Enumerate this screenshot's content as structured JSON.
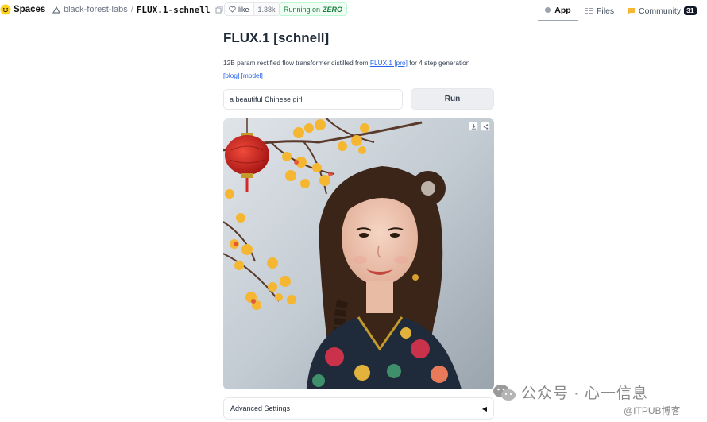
{
  "header": {
    "brand": "Spaces",
    "org": "black-forest-labs",
    "separator": "/",
    "repo": "FLUX.1-schnell",
    "like_label": "like",
    "like_count": "1.38k",
    "status_prefix": "Running on",
    "status_hw": "ZERO",
    "nav": {
      "app": "App",
      "files": "Files",
      "community": "Community",
      "community_count": "31"
    }
  },
  "main": {
    "title": "FLUX.1 [schnell]",
    "desc_before": "12B param rectified flow transformer distilled from ",
    "desc_link": "FLUX.1 [pro]",
    "desc_after": " for 4 step generation",
    "blog_link": "[blog]",
    "model_link": "[model]",
    "prompt_value": "a beautiful Chinese girl",
    "run_label": "Run",
    "advanced_label": "Advanced Settings",
    "advanced_arrow": "◀"
  },
  "watermark": {
    "line1": "公众号 · 心一信息",
    "line2": "@ITPUB博客"
  },
  "colors": {
    "link": "#2563eb",
    "running_green": "#15803d",
    "lantern_red": "#d62828",
    "blossom_yellow": "#f5b731"
  }
}
